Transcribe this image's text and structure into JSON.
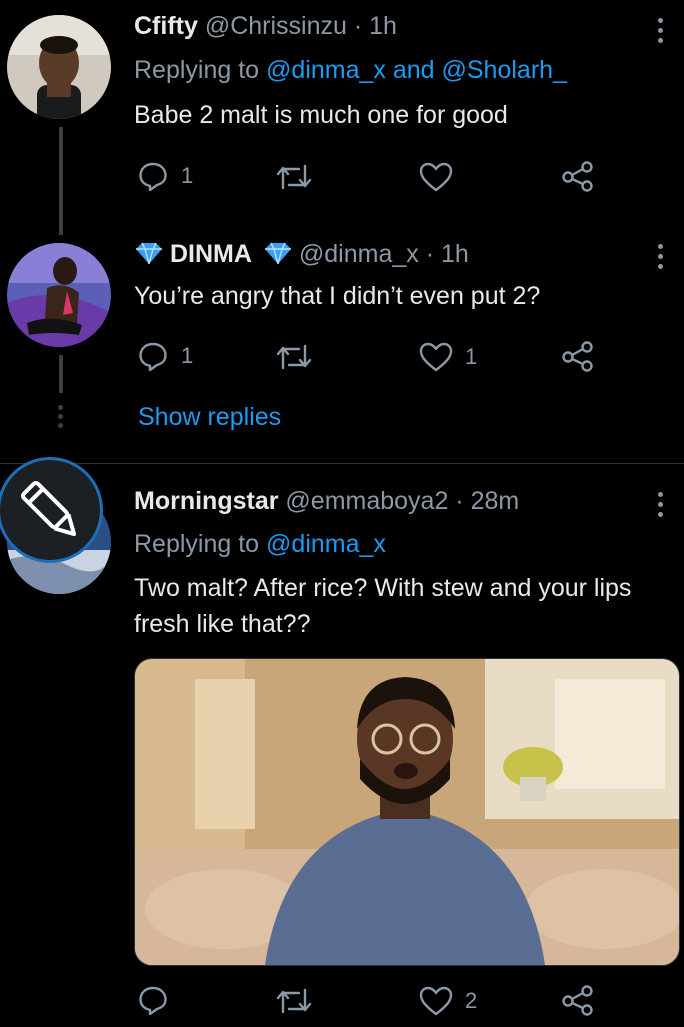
{
  "tweets": [
    {
      "name": "Cfifty",
      "handle": "@Chrissinzu",
      "time": "· 1h",
      "replying_prefix": "Replying to ",
      "replying_to": "@dinma_x and @Sholarh_",
      "text": "Babe 2 malt is much one for good",
      "replies": "1",
      "retweets": "",
      "likes": ""
    },
    {
      "name": "DINMA",
      "handle": "@dinma_x",
      "time": "· 1h",
      "text": "You’re angry that I didn’t even put 2?",
      "replies": "1",
      "retweets": "",
      "likes": "1",
      "show_replies": "Show replies"
    },
    {
      "name": "Morningstar",
      "handle": "@emmaboya2",
      "time": "· 28m",
      "replying_prefix": "Replying to ",
      "replying_to": "@dinma_x",
      "text_line1": "Two malt? After rice? With stew and your lips",
      "text_line2": "fresh like that??",
      "replies": "",
      "retweets": "",
      "likes": "2"
    }
  ],
  "colors": {
    "background": "#000000",
    "link": "#1d9bf0",
    "muted": "#8b98a5",
    "verified": "#3aa0f5"
  },
  "icons": [
    "reply-icon",
    "retweet-icon",
    "like-icon",
    "share-icon",
    "more-icon",
    "verified-diamond-icon",
    "pencil-icon"
  ]
}
